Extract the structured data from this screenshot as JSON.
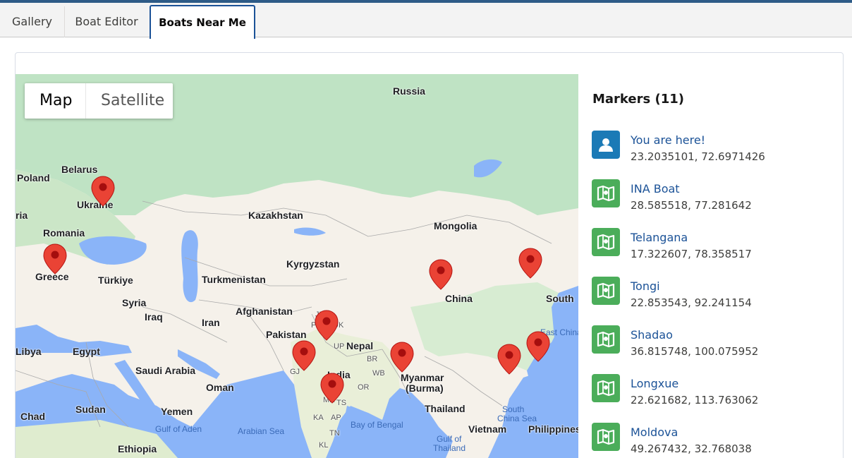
{
  "tabs": [
    {
      "label": "Gallery"
    },
    {
      "label": "Boat Editor"
    },
    {
      "label": "Boats Near Me"
    }
  ],
  "map": {
    "type_control": {
      "map_label": "Map",
      "satellite_label": "Satellite"
    },
    "labels": {
      "russia": "Russia",
      "belarus": "Belarus",
      "poland": "Poland",
      "ukraine": "Ukraine",
      "kazakhstan": "Kazakhstan",
      "mongolia": "Mongolia",
      "romania": "Romania",
      "greece": "Greece",
      "turkiye": "Türkiye",
      "kyrgyzstan": "Kyrgyzstan",
      "turkmenistan": "Turkmenistan",
      "china": "China",
      "south": "South",
      "syria": "Syria",
      "iraq": "Iraq",
      "iran": "Iran",
      "afghanistan": "Afghanistan",
      "pakistan": "Pakistan",
      "nepal": "Nepal",
      "libya": "Libya",
      "egypt": "Egypt",
      "saudi_arabia": "Saudi Arabia",
      "oman": "Oman",
      "india": "India",
      "myanmar": "Myanmar",
      "burma": "(Burma)",
      "chad": "Chad",
      "sudan": "Sudan",
      "yemen": "Yemen",
      "thailand": "Thailand",
      "vietnam": "Vietnam",
      "philippines": "Philippines",
      "ethiopia": "Ethiopia",
      "gulf_of_aden": "Gulf of Aden",
      "arabian_sea": "Arabian Sea",
      "bay_of_bengal": "Bay of Bengal",
      "south_china_sea_1": "South",
      "south_china_sea_2": "China Sea",
      "east_china": "East China",
      "gulf_of": "Gulf of",
      "thailand_gulf": "Thailand",
      "ria": "ria",
      "pb": "PB",
      "jk": "JK",
      "uk": "UK",
      "up": "UP",
      "gj": "GJ",
      "mh": "MH",
      "ts": "TS",
      "or": "OR",
      "ka": "KA",
      "ap": "AP",
      "tn": "TN",
      "kl": "KL",
      "br": "BR",
      "wb": "WB"
    }
  },
  "markers_panel": {
    "title": "Markers (11)",
    "items": [
      {
        "name": "You are here!",
        "coords": "23.2035101, 72.6971426",
        "icon": "user-icon"
      },
      {
        "name": "INA Boat",
        "coords": "28.585518, 77.281642",
        "icon": "map-icon"
      },
      {
        "name": "Telangana",
        "coords": "17.322607, 78.358517",
        "icon": "map-icon"
      },
      {
        "name": "Tongi",
        "coords": "22.853543, 92.241154",
        "icon": "map-icon"
      },
      {
        "name": "Shadao",
        "coords": "36.815748, 100.075952",
        "icon": "map-icon"
      },
      {
        "name": "Longxue",
        "coords": "22.621682, 113.763062",
        "icon": "map-icon"
      },
      {
        "name": "Moldova",
        "coords": "49.267432, 32.768038",
        "icon": "map-icon"
      }
    ]
  },
  "colors": {
    "accent": "#1b5297",
    "user_icon_bg": "#1b7ab6",
    "boat_icon_bg": "#4bad5a",
    "marker_pin": "#ea4335"
  }
}
